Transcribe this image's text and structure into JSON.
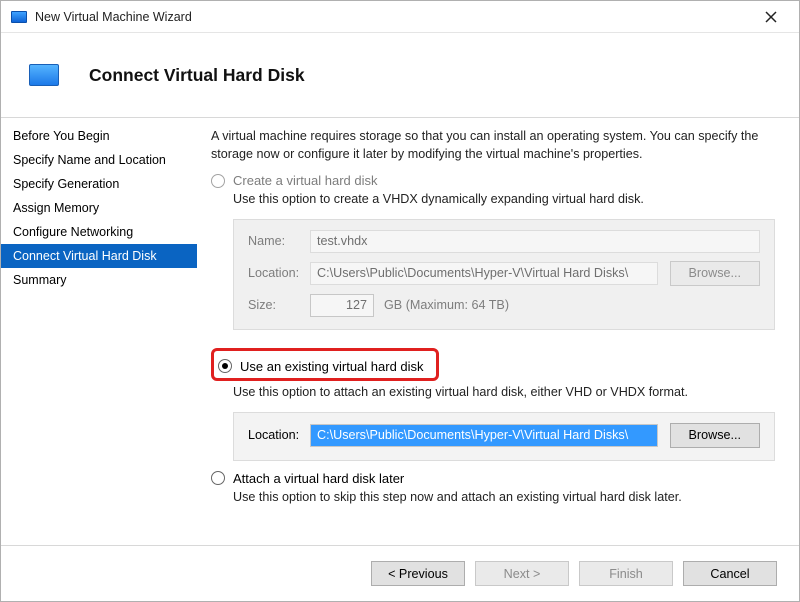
{
  "window": {
    "title": "New Virtual Machine Wizard"
  },
  "header": {
    "page_title": "Connect Virtual Hard Disk"
  },
  "sidebar": {
    "steps": [
      "Before You Begin",
      "Specify Name and Location",
      "Specify Generation",
      "Assign Memory",
      "Configure Networking",
      "Connect Virtual Hard Disk",
      "Summary"
    ],
    "active_index": 5
  },
  "intro": "A virtual machine requires storage so that you can install an operating system. You can specify the storage now or configure it later by modifying the virtual machine's properties.",
  "options": {
    "create": {
      "label": "Create a virtual hard disk",
      "sub": "Use this option to create a VHDX dynamically expanding virtual hard disk.",
      "name_label": "Name:",
      "name_value": "test.vhdx",
      "location_label": "Location:",
      "location_value": "C:\\Users\\Public\\Documents\\Hyper-V\\Virtual Hard Disks\\",
      "browse_label": "Browse...",
      "size_label": "Size:",
      "size_value": "127",
      "size_unit": "GB (Maximum: 64 TB)"
    },
    "existing": {
      "label": "Use an existing virtual hard disk",
      "sub": "Use this option to attach an existing virtual hard disk, either VHD or VHDX format.",
      "location_label": "Location:",
      "location_value": "C:\\Users\\Public\\Documents\\Hyper-V\\Virtual Hard Disks\\",
      "browse_label": "Browse..."
    },
    "later": {
      "label": "Attach a virtual hard disk later",
      "sub": "Use this option to skip this step now and attach an existing virtual hard disk later."
    }
  },
  "footer": {
    "previous": "< Previous",
    "next": "Next >",
    "finish": "Finish",
    "cancel": "Cancel"
  }
}
